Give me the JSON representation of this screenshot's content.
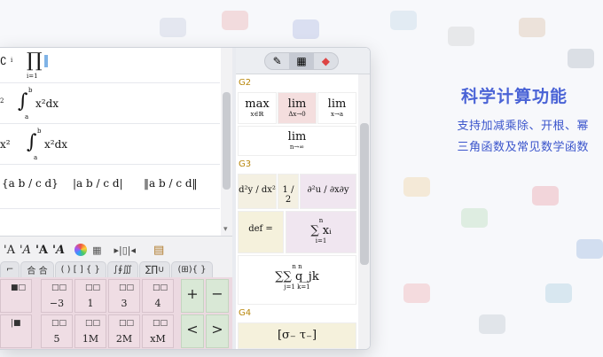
{
  "marketing": {
    "headline": "科学计算功能",
    "sub_line1": "支持加减乘除、开根、幂",
    "sub_line2": "三角函数及常见数学函数"
  },
  "editor": {
    "rows": [
      {
        "left": "∁",
        "left_sup": "i",
        "left_sub": "i",
        "product_symbol": "∏",
        "prod_sub": "i=1"
      },
      {
        "pre": "2",
        "integral": "∫",
        "upper": "b",
        "lower": "a",
        "expr": "x²dx"
      },
      {
        "pre": "x²",
        "integral": "∫",
        "upper": "b",
        "lower": "a",
        "expr": "x²dx"
      },
      {
        "m1": "{a b / c d}",
        "m2": "|a b / c d|",
        "m3": "‖a b / c d‖"
      }
    ]
  },
  "palette": {
    "style_buttons": [
      "'A",
      "'A",
      "'A",
      "'A"
    ],
    "tabs": [
      "⌐",
      "合 合",
      "( ) [ ] { }",
      "∫∮∭",
      "∑∏∪",
      "(⊞){ }"
    ],
    "cells": [
      {
        "top": "□□",
        "bottom": "−3"
      },
      {
        "top": "□□",
        "bottom": "1"
      },
      {
        "top": "□□",
        "bottom": "3"
      },
      {
        "top": "□□",
        "bottom": "4"
      },
      {
        "top": "□□",
        "bottom": "5"
      },
      {
        "top": "□□",
        "bottom": "1M"
      },
      {
        "top": "□□",
        "bottom": "2M"
      },
      {
        "top": "□□",
        "bottom": "xM"
      }
    ],
    "ops": [
      "+",
      "−",
      "<",
      ">",
      "⊄",
      "⊆"
    ]
  },
  "right_panel": {
    "groups": [
      "G2",
      "G3",
      "G4"
    ],
    "templates_g2": [
      {
        "top": "max",
        "sub": "x∈ℝ"
      },
      {
        "top": "lim",
        "sub": "Δx→0"
      },
      {
        "top": "lim",
        "sub": "x→a"
      },
      {
        "top": "lim",
        "sub": "n→∞"
      }
    ],
    "templates_g3": [
      {
        "top": "d²y / dx²"
      },
      {
        "top": "1 / 2"
      },
      {
        "top": "∂²u / ∂x∂y"
      },
      {
        "top": "def ="
      },
      {
        "top": "∑ xᵢ",
        "sub": "i=1",
        "sup": "n"
      },
      {
        "top": "∑∑ q_jk",
        "sub": "j=1  k=1",
        "sup": "n  n"
      }
    ],
    "g4_partial": "[σ₋  τ₋]"
  }
}
